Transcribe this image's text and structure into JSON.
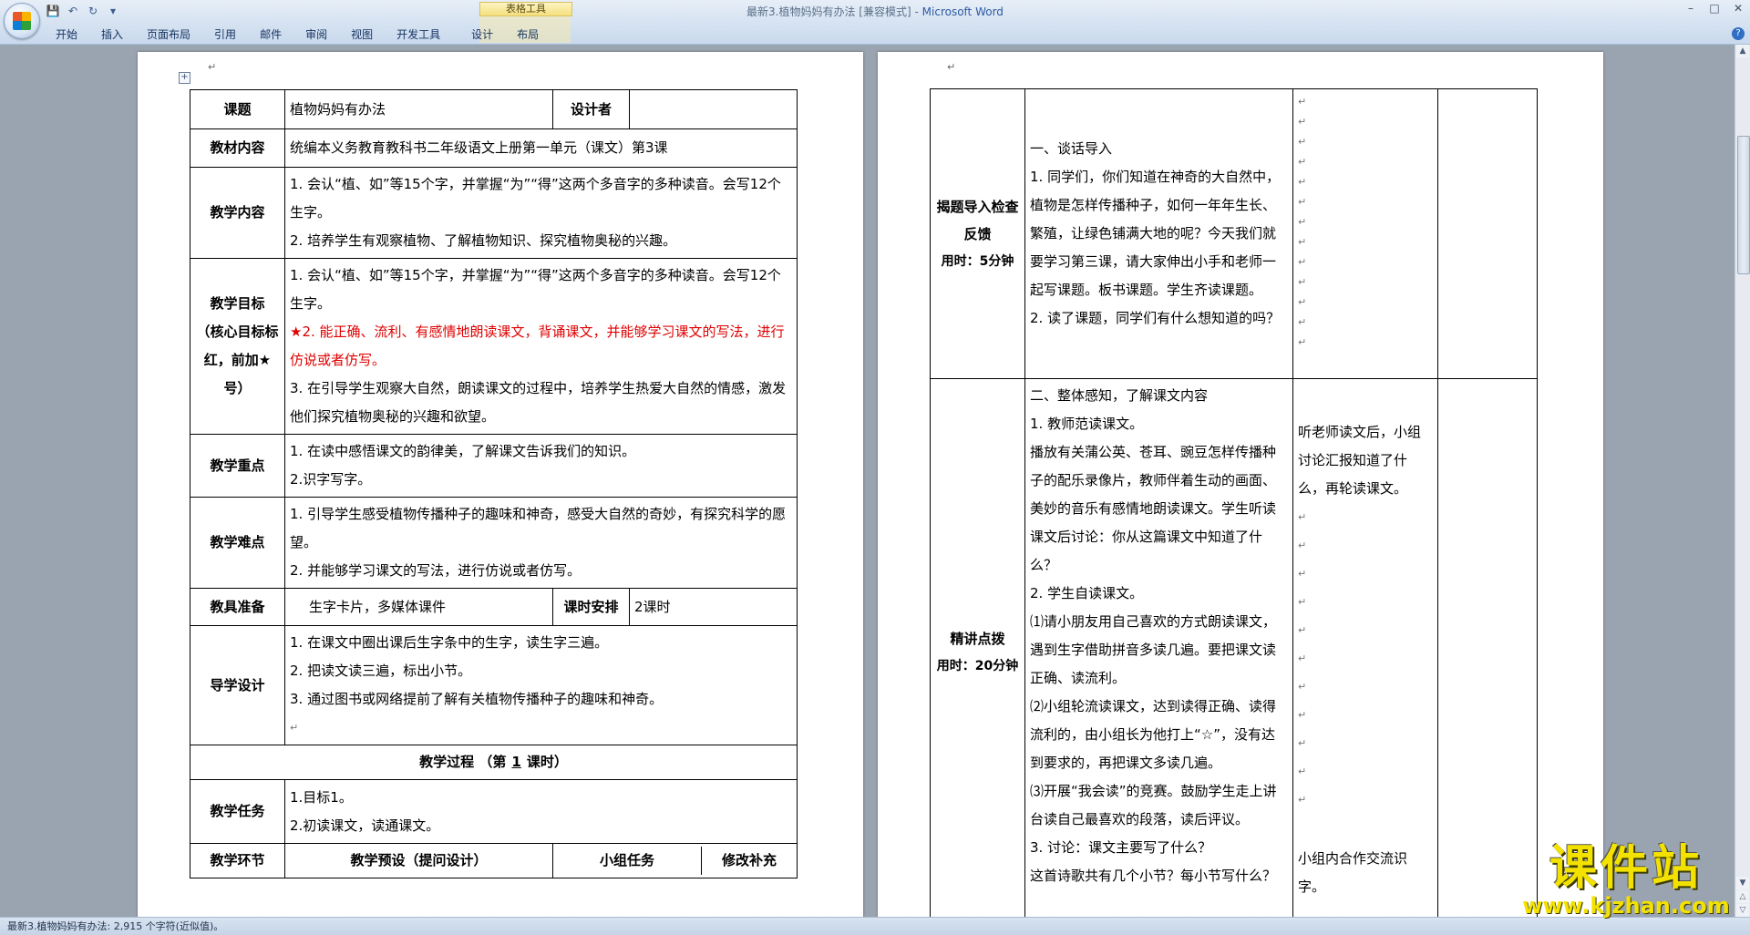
{
  "window": {
    "doc_title": "最新3.植物妈妈有办法 [兼容模式]",
    "title_separator": " - ",
    "app_name": "Microsoft Word"
  },
  "ribbon": {
    "context_label": "表格工具",
    "tabs": [
      "开始",
      "插入",
      "页面布局",
      "引用",
      "邮件",
      "审阅",
      "视图",
      "开发工具",
      "设计",
      "布局"
    ]
  },
  "statusbar": {
    "text": "最新3.植物妈妈有办法: 2,915 个字符(近似值)。"
  },
  "watermark": {
    "title": "课件站",
    "url": "www.kjzhan.com"
  },
  "page1": {
    "ketí_label": "课题",
    "keti_value": "植物妈妈有办法",
    "designer_label": "设计者",
    "designer_value": "",
    "jiaocai_label": "教材内容",
    "jiaocai_value": "统编本义务教育教科书二年级语文上册第一单元（课文）第3课",
    "neirong_label": "教学内容",
    "neirong_lines": [
      "1. 会认“植、如”等15个字，并掌握“为”“得”这两个多音字的多种读音。会写12个生字。",
      "2. 培养学生有观察植物、了解植物知识、探究植物奥秘的兴趣。"
    ],
    "mubiao_label": "教学目标",
    "mubiao_sub": "（核心目标标红，前加★号）",
    "mubiao_line1": "1. 会认“植、如”等15个字，并掌握“为”“得”这两个多音字的多种读音。会写12个生字。",
    "mubiao_line2": "★2. 能正确、流利、有感情地朗读课文，背诵课文，并能够学习课文的写法，进行仿说或者仿写。",
    "mubiao_line3": "3. 在引导学生观察大自然，朗读课文的过程中，培养学生热爱大自然的情感，激发他们探究植物奥秘的兴趣和欲望。",
    "zhongdian_label": "教学重点",
    "zhongdian_lines": [
      "1. 在读中感悟课文的韵律美，了解课文告诉我们的知识。",
      "2.识字写字。"
    ],
    "nandian_label": "教学难点",
    "nandian_lines": [
      "1. 引导学生感受植物传播种子的趣味和神奇，感受大自然的奇妙，有探究科学的愿望。",
      "2. 并能够学习课文的写法，进行仿说或者仿写。"
    ],
    "jiaoju_label": "教具准备",
    "jiaoju_value": "生字卡片，多媒体课件",
    "keshi_label": "课时安排",
    "keshi_value": "2课时",
    "daoxue_label": "导学设计",
    "daoxue_lines": [
      "1. 在课文中圈出课后生字条中的生字，读生字三遍。",
      "2. 把读文读三遍，标出小节。",
      "3. 通过图书或网络提前了解有关植物传播种子的趣味和神奇。"
    ],
    "guocheng_prefix": "教学过程 （第",
    "guocheng_num": "1",
    "guocheng_suffix": "课时）",
    "renwu_label": "教学任务",
    "renwu_lines": [
      "1.目标1。",
      "2.初读课文，读通课文。"
    ],
    "huanjie_label": "教学环节",
    "yushe_label": "教学预设（提问设计）",
    "xiaozu_label": "小组任务",
    "buchong_label": "修改补充"
  },
  "page2": {
    "row1_label": "揭题导入检查反馈",
    "row1_time": "用时：5分钟",
    "row1_lines": [
      "一、谈话导入",
      "1. 同学们，你们知道在神奇的大自然中，植物是怎样传播种子，如何一年年生长、繁殖，让绿色铺满大地的呢？今天我们就要学习第三课，请大家伸出小手和老师一起写课题。板书课题。学生齐读课题。",
      "2. 读了课题，同学们有什么想知道的吗？"
    ],
    "row2_label": "精讲点拨",
    "row2_time": "用时：20分钟",
    "row2_lines": [
      "二、整体感知，了解课文内容",
      "1. 教师范读课文。",
      "播放有关蒲公英、苍耳、豌豆怎样传播种子的配乐录像片，教师伴着生动的画面、美妙的音乐有感情地朗读课文。学生听读课文后讨论：你从这篇课文中知道了什么？",
      "2. 学生自读课文。",
      "⑴请小朋友用自己喜欢的方式朗读课文，遇到生字借助拼音多读几遍。要把课文读正确、读流利。",
      "⑵小组轮流读课文，达到读得正确、读得流利的，由小组长为他打上“☆”，没有达到要求的，再把课文多读几遍。",
      "⑶开展“我会读”的竞赛。鼓励学生走上讲台读自己最喜欢的段落，读后评议。",
      "3. 讨论：课文主要写了什么？",
      "这首诗歌共有几个小节？每小节写什么？"
    ],
    "row2_group_task1": "听老师读文后，小组讨论汇报知道了什么，再轮读课文。",
    "row2_group_task2": "小组内合作交流识字。"
  }
}
